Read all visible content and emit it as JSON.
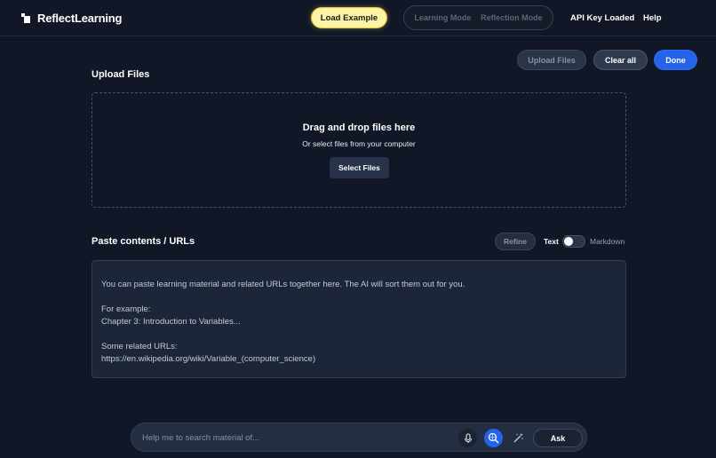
{
  "header": {
    "app_name": "ReflectLearning",
    "load_example": "Load Example",
    "modes": [
      "Learning Mode",
      "Reflection Mode"
    ],
    "api_status": "API Key Loaded",
    "help": "Help"
  },
  "actions": {
    "upload_files": "Upload Files",
    "clear_all": "Clear all",
    "done": "Done"
  },
  "upload": {
    "title": "Upload Files",
    "drop_title": "Drag and drop files here",
    "drop_subtitle": "Or select files from your computer",
    "select_files": "Select Files"
  },
  "paste": {
    "title": "Paste contents / URLs",
    "refine": "Refine",
    "toggle_left": "Text",
    "toggle_right": "Markdown",
    "lines": [
      "You can paste learning material and related URLs together here. The AI will sort them out for you.",
      "",
      "For example:",
      "Chapter 3: Introduction to Variables...",
      "",
      "Some related URLs:",
      "https://en.wikipedia.org/wiki/Variable_(computer_science)"
    ]
  },
  "askbar": {
    "placeholder": "Help me to search material of...",
    "ask": "Ask",
    "icons": [
      "microphone-icon",
      "web-search-icon",
      "magic-wand-icon"
    ]
  },
  "colors": {
    "background": "#111726",
    "accent": "#2563eb",
    "load_example_bg": "#fcf3a6"
  }
}
